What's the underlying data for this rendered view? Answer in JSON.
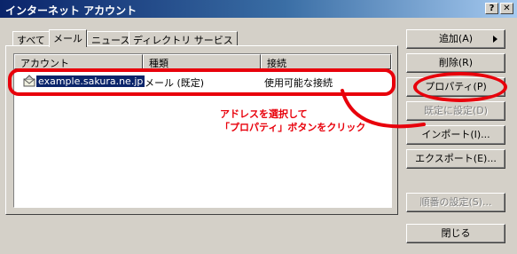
{
  "window": {
    "title": "インターネット アカウント",
    "help_label": "?",
    "close_label": "✕",
    "accent": "#0a246a",
    "title_gradient_end": "#a6caf0"
  },
  "tabs": [
    {
      "label": "すべて",
      "active": false
    },
    {
      "label": "メール",
      "active": true
    },
    {
      "label": "ニュース",
      "active": false
    },
    {
      "label": "ディレクトリ サービス",
      "active": false
    }
  ],
  "table": {
    "columns": [
      "アカウント",
      "種類",
      "接続"
    ],
    "rows": [
      {
        "account": "example.sakura.ne.jp",
        "type": "メール (既定)",
        "connection": "使用可能な接続",
        "icon": "mail-account-icon"
      }
    ]
  },
  "buttons": {
    "add": "追加(A)",
    "delete": "削除(R)",
    "properties": "プロパティ(P)",
    "set_default": "既定に設定(D)",
    "import": "インポート(I)...",
    "export": "エクスポート(E)...",
    "order": "順番の設定(S)...",
    "close": "閉じる"
  },
  "annotation": {
    "line1": "アドレスを選択して",
    "line2": "「プロパティ」ボタンをクリック",
    "color": "#e8000b"
  }
}
